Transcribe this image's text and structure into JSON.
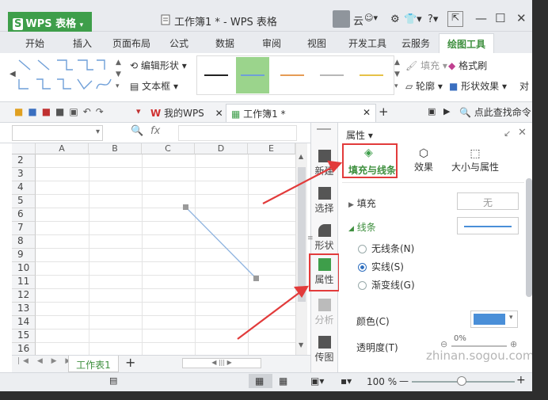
{
  "app": {
    "logo_letter": "S",
    "name": "WPS 表格",
    "window_title": "工作簿1 * - WPS 表格"
  },
  "user": {
    "name": "云"
  },
  "window_controls": {
    "minimize": "—",
    "maximize": "☐",
    "close": "✕",
    "help": "?"
  },
  "tabs": [
    {
      "label": "开始"
    },
    {
      "label": "插入"
    },
    {
      "label": "页面布局"
    },
    {
      "label": "公式"
    },
    {
      "label": "数据"
    },
    {
      "label": "审阅"
    },
    {
      "label": "视图"
    },
    {
      "label": "开发工具"
    },
    {
      "label": "云服务"
    },
    {
      "label": "绘图工具"
    }
  ],
  "ribbon": {
    "edit_shape": "编辑形状",
    "text_box": "文本框",
    "fill": "填充",
    "format_painter": "格式刷",
    "outline": "轮廓",
    "shape_effects": "形状效果",
    "right_cut": "对",
    "line_colors": [
      "#222222",
      "#6f9fd8",
      "#e59b55",
      "#b7b7b7",
      "#e6c247"
    ]
  },
  "quick_toolbar": {
    "my_wps": "我的WPS",
    "doc_tab": "工作簿1 *",
    "search": "点此查找命令"
  },
  "formula_bar": {
    "fx": "fx"
  },
  "grid": {
    "columns": [
      "A",
      "B",
      "C",
      "D",
      "E"
    ],
    "rows": [
      "2",
      "3",
      "4",
      "5",
      "6",
      "7",
      "8",
      "9",
      "10",
      "11",
      "12",
      "13",
      "14",
      "15",
      "16"
    ]
  },
  "sheet": {
    "name": "工作表1",
    "add": "+"
  },
  "status": {
    "zoom": "100 %"
  },
  "sidebar": [
    {
      "label": "新建"
    },
    {
      "label": "选择"
    },
    {
      "label": "形状"
    },
    {
      "label": "属性"
    },
    {
      "label": "分析"
    },
    {
      "label": "传图"
    }
  ],
  "panel": {
    "title": "属性",
    "tabs": [
      {
        "label": "填充与线条"
      },
      {
        "label": "效果"
      },
      {
        "label": "大小与属性"
      }
    ],
    "fill_label": "填充",
    "fill_value": "无",
    "line_label": "线条",
    "line_options": [
      {
        "label": "无线条(N)"
      },
      {
        "label": "实线(S)"
      },
      {
        "label": "渐变线(G)"
      }
    ],
    "color_label": "颜色(C)",
    "color_value": "#4a8fd8",
    "transparency_label": "透明度(T)",
    "transparency_value": "0%"
  },
  "watermark": "zhinan.sogou.com"
}
